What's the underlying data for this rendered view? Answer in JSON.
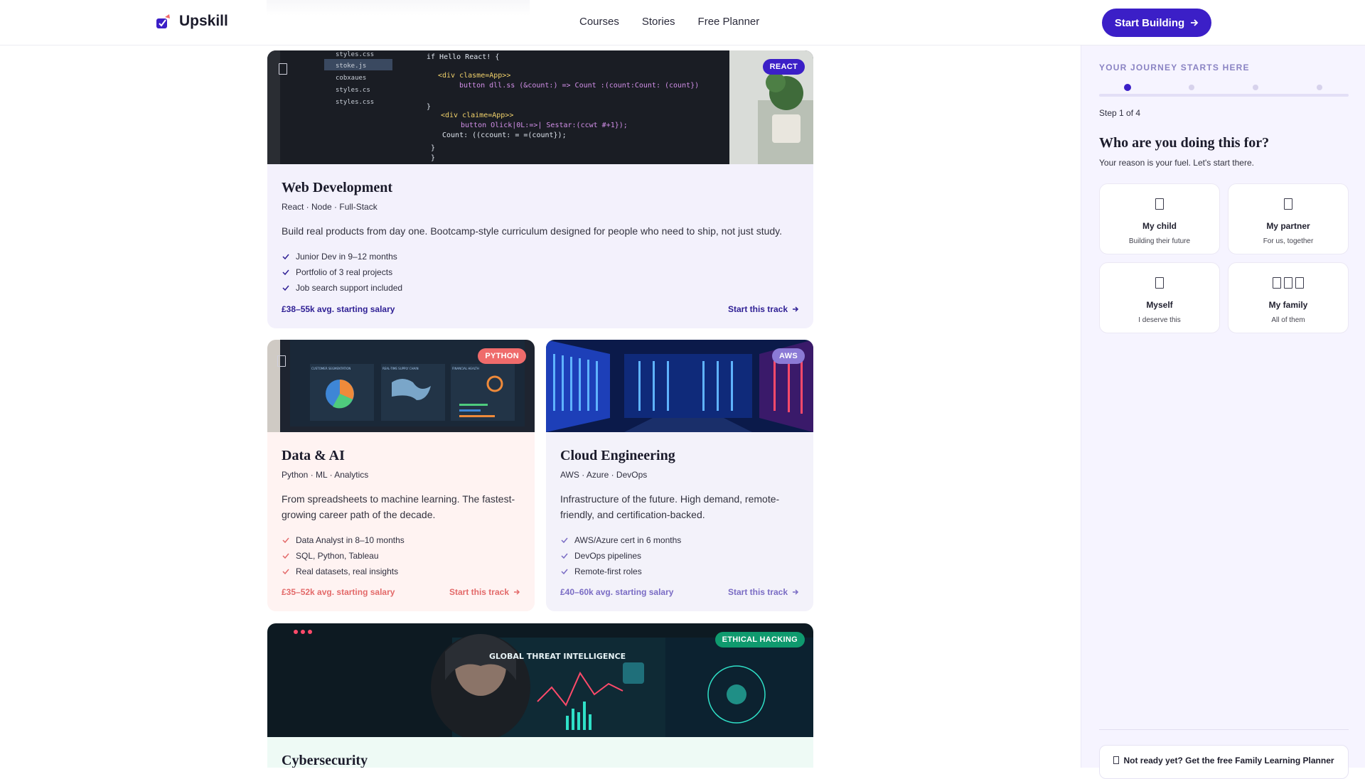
{
  "header": {
    "brand": "Upskill",
    "nav": [
      "Courses",
      "Stories",
      "Free Planner"
    ],
    "cta_label": "Start Building",
    "brand_color": "#3b1fc7"
  },
  "tracks": [
    {
      "badge": "REACT",
      "badge_color": "#3b1fc7",
      "title": "Web Development",
      "tags": "React · Node · Full-Stack",
      "description": "Build real products from day one. Bootcamp-style curriculum designed for people who need to ship, not just study.",
      "features": [
        "Junior Dev in 9–12 months",
        "Portfolio of 3 real projects",
        "Job search support included"
      ],
      "salary": "£38–55k avg. starting salary",
      "link": "Start this track",
      "accent": "#2e1f94",
      "bg": "#f3f1fc"
    },
    {
      "badge": "PYTHON",
      "badge_color": "#ef6b6b",
      "title": "Data & AI",
      "tags": "Python · ML · Analytics",
      "description": "From spreadsheets to machine learning. The fastest-growing career path of the decade.",
      "features": [
        "Data Analyst in 8–10 months",
        "SQL, Python, Tableau",
        "Real datasets, real insights"
      ],
      "salary": "£35–52k avg. starting salary",
      "link": "Start this track",
      "accent": "#e36a6a",
      "bg": "#fff3f2"
    },
    {
      "badge": "AWS",
      "badge_color": "#8b7ad6",
      "title": "Cloud Engineering",
      "tags": "AWS · Azure · DevOps",
      "description": "Infrastructure of the future. High demand, remote-friendly, and certification-backed.",
      "features": [
        "AWS/Azure cert in 6 months",
        "DevOps pipelines",
        "Remote-first roles"
      ],
      "salary": "£40–60k avg. starting salary",
      "link": "Start this track",
      "accent": "#7a6cc4",
      "bg": "#f3f2fa"
    },
    {
      "badge": "ETHICAL HACKING",
      "badge_color": "#0f9a6e",
      "title": "Cybersecurity",
      "accent": "#0f9a6e",
      "bg": "#eefaf5"
    }
  ],
  "media_text": {
    "files": [
      "styles.css",
      "stoke.js",
      "cobxaues",
      "styles.cs",
      "styles.css"
    ],
    "code": [
      "if Hello React! {",
      "<div clasme=App>>",
      "button dll.ss (&count:) => Count :(count:Count: (count})",
      "}",
      "<div claime=App>>",
      "button Olick|0L:=>| Sestar:(ccwt #+1});",
      "Count: ((ccount: = =(count});",
      "}",
      "}"
    ],
    "dash": [
      "CUSTOMER SEGMENTATION",
      "REAL-TIME SUPPLY CHAIN",
      "FINANCIAL HEALTH"
    ],
    "threat": "GLOBAL THREAT INTELLIGENCE"
  },
  "sidebar": {
    "kicker": "YOUR JOURNEY STARTS HERE",
    "step": "Step 1 of 4",
    "question": "Who are you doing this for?",
    "subtitle": "Your reason is your fuel. Let's start there.",
    "options": [
      {
        "title": "My child",
        "sub": "Building their future"
      },
      {
        "title": "My partner",
        "sub": "For us, together"
      },
      {
        "title": "Myself",
        "sub": "I deserve this"
      },
      {
        "title": "My family",
        "sub": "All of them"
      }
    ],
    "planner": "Not ready yet? Get the free Family Learning Planner"
  }
}
